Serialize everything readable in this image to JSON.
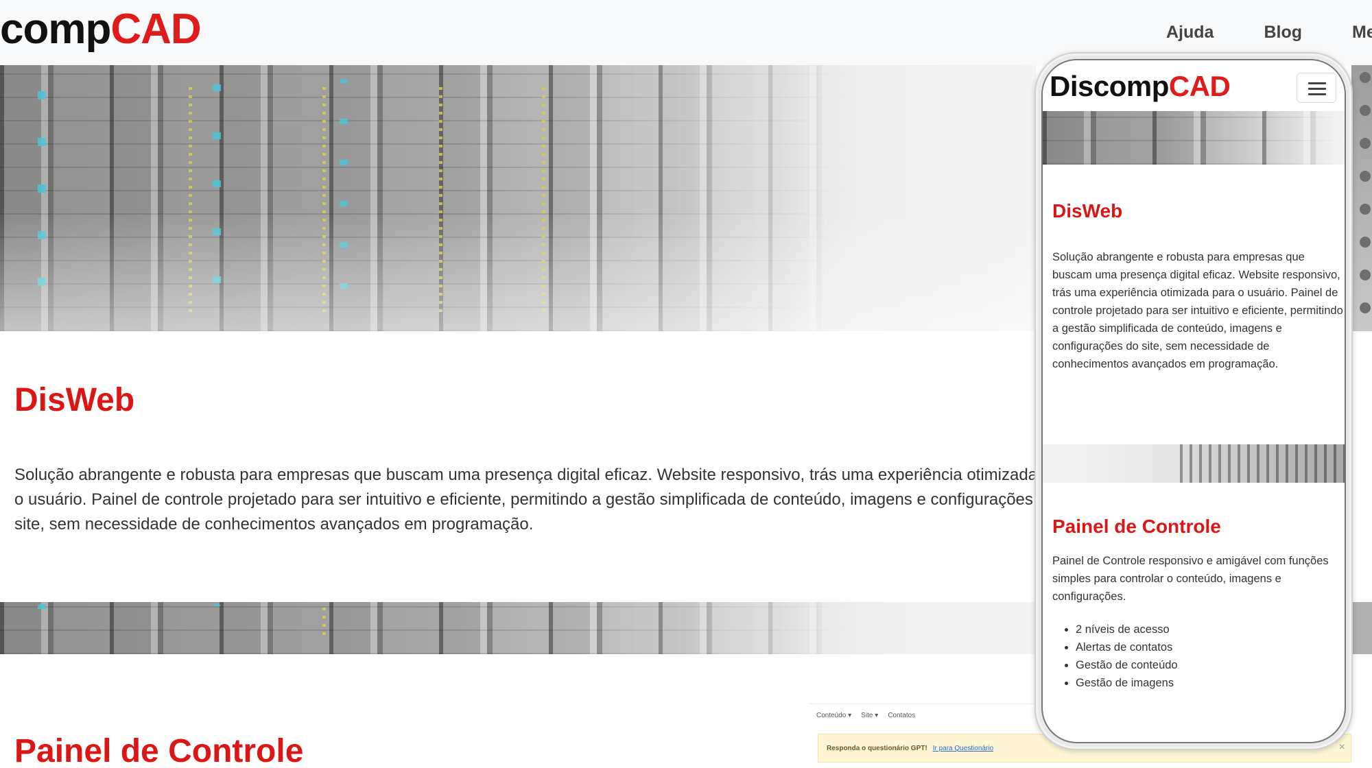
{
  "header": {
    "logo_prefix": "comp",
    "logo_suffix": "CAD",
    "nav": [
      {
        "label": "Ajuda"
      },
      {
        "label": "Blog"
      },
      {
        "label": "Me"
      }
    ]
  },
  "main": {
    "sections": [
      {
        "title": "DisWeb",
        "body": "Solução abrangente e robusta para empresas que buscam uma presença digital eficaz. Website responsivo, trás uma experiência otimizada para o usuário. Painel de controle projetado para ser intuitivo e eficiente, permitindo a gestão simplificada de conteúdo, imagens e configurações do site, sem necessidade de conhecimentos avançados em programação."
      },
      {
        "title": "Painel de Controle"
      }
    ]
  },
  "admin_preview": {
    "menu": [
      "Conteúdo ▾",
      "Site ▾",
      "Contatos"
    ],
    "alert_text": "Responda o questionário GPT!",
    "alert_link": "Ir para Questionário",
    "close_symbol": "×"
  },
  "phone": {
    "logo_prefix": "Discomp",
    "logo_suffix": "CAD",
    "menu_icon": "hamburger-icon",
    "sections": [
      {
        "title": "DisWeb",
        "body": "Solução abrangente e robusta para empresas que buscam uma presença digital eficaz. Website responsivo, trás uma experiência otimizada para o usuário. Painel de controle projetado para ser intuitivo e eficiente, permitindo a gestão simplificada de conteúdo, imagens e configurações do site, sem necessidade de conhecimentos avançados em programação."
      },
      {
        "title": "Painel de Controle",
        "body": "Painel de Controle responsivo e amigável com funções simples para controlar o conteúdo, imagens e configurações.",
        "features": [
          "2 níveis de acesso",
          "Alertas de contatos",
          "Gestão de conteúdo",
          "Gestão de imagens"
        ]
      }
    ]
  },
  "colors": {
    "brand_red": "#e01b1b",
    "heading_red": "#dc1515",
    "header_bg": "#f8f9fa"
  }
}
